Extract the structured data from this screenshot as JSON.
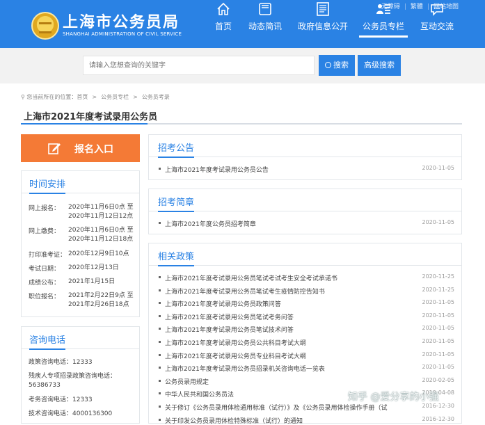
{
  "header": {
    "logo_title": "上海市公务员局",
    "logo_subtitle": "SHANGHAI ADMINISTRATION OF CIVIL SERVICE",
    "top_links": [
      "无障碍",
      "繁體",
      "网站地图"
    ],
    "nav": [
      {
        "label": "首页",
        "icon": "home-icon"
      },
      {
        "label": "动态简讯",
        "icon": "news-icon"
      },
      {
        "label": "政府信息公开",
        "icon": "document-icon"
      },
      {
        "label": "公务员专栏",
        "icon": "people-list-icon"
      },
      {
        "label": "互动交流",
        "icon": "chat-icon"
      }
    ]
  },
  "search": {
    "placeholder": "请输入您想查询的关键字",
    "search_label": "搜索",
    "advanced_label": "高级搜索"
  },
  "breadcrumb": {
    "prefix": "您当前所在的位置：首页",
    "items": [
      "公务员专栏",
      "公务员考录"
    ]
  },
  "page_title": "上海市2021年度考试录用公务员",
  "signup_label": "报名入口",
  "schedule": {
    "title": "时间安排",
    "rows": [
      {
        "key": "网上报名：",
        "value": "2020年11月6日0点 至\n2020年11月12日12点"
      },
      {
        "key": "网上缴费：",
        "value": "2020年11月6日0点 至\n2020年11月12日18点"
      },
      {
        "key": "打印准考证：",
        "value": "2020年12月9日10点"
      },
      {
        "key": "考试日期：",
        "value": "2020年12月13日"
      },
      {
        "key": "成绩公布：",
        "value": "2021年1月15日"
      },
      {
        "key": "职位报名：",
        "value": "2021年2月22日9点 至\n2021年2月26日18点"
      }
    ]
  },
  "consult": {
    "title": "咨询电话",
    "lines": [
      "政策咨询电话：12333",
      "残疾人专项招录政策咨询电话：\n56386733",
      "考务咨询电话：12333",
      "技术咨询电话：4000136300"
    ]
  },
  "notice": {
    "title": "招考公告",
    "items": [
      {
        "text": "上海市2021年度考试录用公务员公告",
        "date": "2020-11-05"
      }
    ]
  },
  "brief": {
    "title": "招考简章",
    "items": [
      {
        "text": "上海市2021年度公务员招考简章",
        "date": "2020-11-05"
      }
    ]
  },
  "policy": {
    "title": "相关政策",
    "items": [
      {
        "text": "上海市2021年度考试录用公务员笔试考试考生安全考试承诺书",
        "date": "2020-11-25"
      },
      {
        "text": "上海市2021年度考试录用公务员笔试考生疫情防控告知书",
        "date": "2020-11-25"
      },
      {
        "text": "上海市2021年度考试录用公务员政策问答",
        "date": "2020-11-05"
      },
      {
        "text": "上海市2021年度考试录用公务员笔试考务问答",
        "date": "2020-11-05"
      },
      {
        "text": "上海市2021年度考试录用公务员笔试技术问答",
        "date": "2020-11-05"
      },
      {
        "text": "上海市2021年度考试录用公务员公共科目考试大纲",
        "date": "2020-11-05"
      },
      {
        "text": "上海市2021年度考试录用公务员专业科目考试大纲",
        "date": "2020-11-05"
      },
      {
        "text": "上海市2021年度考试录用公务员招录机关咨询电话一览表",
        "date": "2020-11-05"
      },
      {
        "text": "公务员录用规定",
        "date": "2020-02-05"
      },
      {
        "text": "中华人民共和国公务员法",
        "date": "2019-04-08"
      },
      {
        "text": "关于修订《公务员录用体检通用标准（试行）》及《公务员录用体检操作手册（试",
        "date": "2016-12-30"
      },
      {
        "text": "关于印发公务员录用体检特殊标准（试行）的通知",
        "date": "2016-12-30"
      }
    ]
  },
  "watermark": "知乎 @爱分享的小强"
}
